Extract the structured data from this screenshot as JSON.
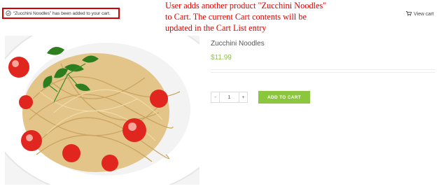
{
  "notice": {
    "text": "“Zucchini Noodles” has been added to your cart."
  },
  "annotation": {
    "lines": [
      "User adds another product \"Zucchini Noodles\"",
      "to Cart. The current Cart contents will be",
      "updated in the Cart List entry"
    ]
  },
  "header": {
    "view_cart_label": "View cart",
    "cart_icon": "cart-icon"
  },
  "product": {
    "title": "Zucchini Noodles",
    "price": "$11.99",
    "quantity": "1",
    "minus_label": "-",
    "plus_label": "+",
    "add_to_cart_label": "ADD TO CART"
  },
  "colors": {
    "accent": "#8cc63f",
    "price": "#8ec44a",
    "annotation": "#e00000",
    "notice_border": "#d40000"
  }
}
